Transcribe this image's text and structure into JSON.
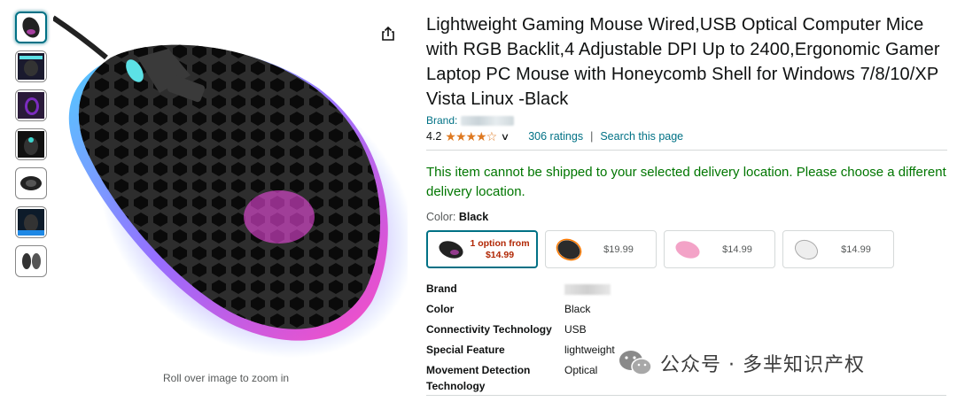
{
  "product": {
    "title": "Lightweight Gaming Mouse Wired,USB Optical Computer Mice with RGB Backlit,4 Adjustable DPI Up to 2400,Ergonomic Gamer Laptop PC Mouse with Honeycomb Shell for Windows 7/8/10/XP Vista Linux -Black",
    "brand_label": "Brand:",
    "rating_value": "4.2",
    "stars": "★★★★☆",
    "rating_count": "306 ratings",
    "separator": "|",
    "search_link": "Search this page",
    "shipping_message": "This item cannot be shipped to your selected delivery location. Please choose a different delivery location.",
    "color_label": "Color:",
    "color_value": "Black"
  },
  "swatches": [
    {
      "price": "1 option from $14.99",
      "color": "#222222"
    },
    {
      "price": "$19.99",
      "color": "#2b2b2b"
    },
    {
      "price": "$14.99",
      "color": "#f3a3c7"
    },
    {
      "price": "$14.99",
      "color": "#eeeeee"
    }
  ],
  "specs": [
    {
      "key": "Brand",
      "value": ""
    },
    {
      "key": "Color",
      "value": "Black"
    },
    {
      "key": "Connectivity Technology",
      "value": "USB"
    },
    {
      "key": "Special Feature",
      "value": "lightweight"
    },
    {
      "key": "Movement Detection Technology",
      "value": "Optical"
    }
  ],
  "zoom_hint": "Roll over image to zoom in",
  "watermark": "公众号 · 多芈知识产权",
  "colors": {
    "link": "#007185",
    "shipping": "#007600",
    "star": "#de7921",
    "price": "#b12704"
  },
  "icons": {
    "share": "share-icon",
    "rating_dropdown": "chevron-down-icon"
  }
}
